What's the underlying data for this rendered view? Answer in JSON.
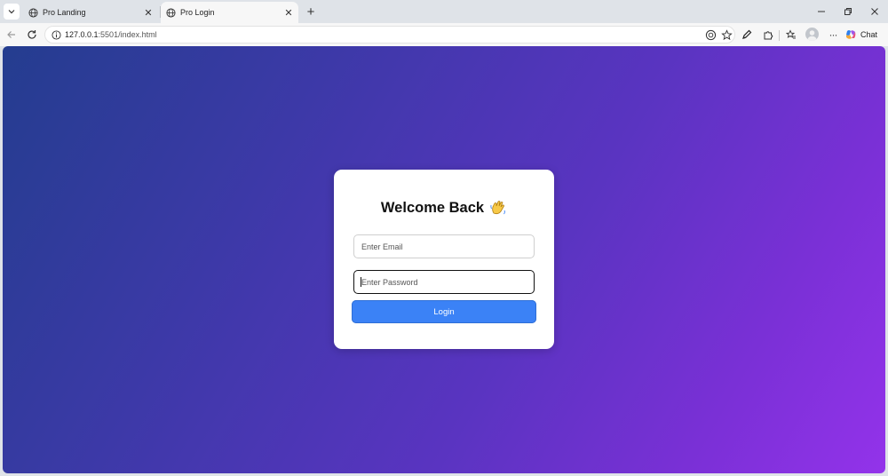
{
  "tabs": [
    {
      "title": "Pro Landing",
      "active": false
    },
    {
      "title": "Pro Login",
      "active": true
    }
  ],
  "toolbar": {
    "url_host": "127.0.0.1",
    "url_rest": ":5501/index.html",
    "chat_label": "Chat"
  },
  "login": {
    "title": "Welcome Back",
    "title_emoji": "waving-hand-icon",
    "email_placeholder": "Enter Email",
    "email_value": "",
    "password_placeholder": "Enter Password",
    "password_value": "",
    "button_label": "Login"
  },
  "colors": {
    "gradient_start": "#243d8f",
    "gradient_end": "#9333ea",
    "button": "#3b82f6",
    "card": "#ffffff"
  }
}
